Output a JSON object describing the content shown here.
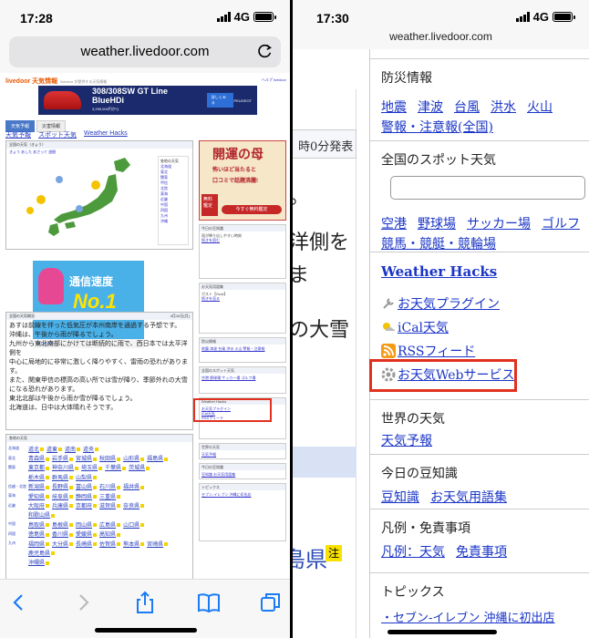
{
  "left": {
    "status": {
      "time": "17:28",
      "network": "4G"
    },
    "url": "weather.livedoor.com",
    "logo": "livedoor 天気情報",
    "logo_sub": "livedoor が提供する天気情報",
    "toplinks": "ヘルプ  livedoor",
    "ad": {
      "title": "308/308SW GT Line BlueHDi",
      "price": "3,299,000円から",
      "button": "詳しくみる",
      "brand": "PEUGEOT"
    },
    "tabs": [
      "天気予報",
      "災害情報"
    ],
    "nav": [
      "天気予報",
      "スポット天気",
      "Weather Hacks"
    ],
    "map": {
      "header": "全国の天気（きょう）",
      "links": "きょう  あした  あさって  週間",
      "regions_title": "各地の天気",
      "regions": [
        "北海道",
        "東北",
        "関東",
        "甲信",
        "北陸",
        "東海",
        "近畿",
        "中国",
        "四国",
        "九州",
        "沖縄"
      ]
    },
    "ad2": {
      "title": "通信速度",
      "no1": "No.1",
      "brand": "UQ mobile"
    },
    "forecast": {
      "header": "全国の天気概況",
      "date": "4月16日(月)",
      "lines": [
        "あすは前線を伴った低気圧が本州南岸を通過する予想です。",
        "沖縄は、午後から雨が降るでしょう。",
        "九州から東北南部にかけては断続的に雨で、西日本では太平洋側を",
        "中心に局地的に非常に激しく降りやすく、雷雨の恐れがあります。",
        "また、関東甲信の標高の高い所では雪が降り、季節外れの大雪",
        "になる恐れがあります。",
        "東北北部は午後から雨か雪が降るでしょう。",
        "北海道は、日中は大体晴れそうです。"
      ]
    },
    "pref": {
      "header": "各地の天気",
      "rows": [
        {
          "region": "北海道",
          "items": [
            "道北",
            "道東",
            "道南",
            "道央"
          ]
        },
        {
          "region": "東北",
          "items": [
            "青森県",
            "岩手県",
            "宮城県",
            "秋田県",
            "山形県",
            "福島県"
          ]
        },
        {
          "region": "関東",
          "items": [
            "東京都",
            "神奈川県",
            "埼玉県",
            "千葉県",
            "茨城県"
          ]
        },
        {
          "region": "",
          "items": [
            "栃木県",
            "群馬県",
            "山梨県"
          ]
        },
        {
          "region": "信越・北陸",
          "items": [
            "新潟県",
            "長野県",
            "富山県",
            "石川県",
            "福井県"
          ]
        },
        {
          "region": "東海",
          "items": [
            "愛知県",
            "岐阜県",
            "静岡県",
            "三重県"
          ]
        },
        {
          "region": "近畿",
          "items": [
            "大阪府",
            "兵庫県",
            "京都府",
            "滋賀県",
            "奈良県"
          ]
        },
        {
          "region": "",
          "items": [
            "和歌山県"
          ]
        },
        {
          "region": "中国",
          "items": [
            "鳥取県",
            "島根県",
            "岡山県",
            "広島県",
            "山口県"
          ]
        },
        {
          "region": "四国",
          "items": [
            "徳島県",
            "香川県",
            "愛媛県",
            "高知県"
          ]
        },
        {
          "region": "九州",
          "items": [
            "福岡県",
            "大分県",
            "長崎県",
            "佐賀県",
            "熊本県",
            "宮崎県"
          ]
        },
        {
          "region": "",
          "items": [
            "鹿児島県"
          ]
        },
        {
          "region": "",
          "items": [
            "沖縄県"
          ]
        }
      ]
    },
    "fortune": {
      "title": "開運の母",
      "line1": "怖いほど当たると",
      "line2": "口コミで話題沸騰!",
      "badge": "無料鑑定",
      "cta": "今すぐ無料鑑定"
    },
    "small_boxes": [
      {
        "title": "今日の豆知識",
        "text": "雨が降り出しやすい時刻",
        "link": "続きを読む"
      },
      {
        "title": "お天気用語集",
        "text": "ガスト【Gust】",
        "link": "続きを見る"
      },
      {
        "title": "防災情報",
        "text": "地震  津波  台風  洪水  火山  警報・注意報",
        "link": ""
      },
      {
        "title": "全国のスポット天気",
        "text": "空港  野球場  サッカー場  ゴルフ場",
        "link": "検索"
      },
      {
        "title": "Weather Hacks",
        "text": "お天気プラグイン",
        "link": "iCal天気"
      },
      {
        "title": "",
        "text": "",
        "link": "RSSフィード"
      },
      {
        "title": "世界の天気",
        "text": "",
        "link": "天気予報"
      },
      {
        "title": "今日の豆知識",
        "text": "",
        "link": "豆知識  お天気用語集"
      },
      {
        "title": "トピックス",
        "text": "セブン-イレブン 沖縄に初出店",
        "link": ""
      }
    ]
  },
  "right": {
    "status": {
      "time": "17:30",
      "network": "4G"
    },
    "url": "weather.livedoor.com",
    "background": {
      "heading": "時0分発表",
      "lines": [
        "。",
        "洋側を",
        "ま",
        "の大雪"
      ],
      "pref_link": "島県",
      "note": "注"
    },
    "bosai": {
      "title": "防災情報",
      "links1": [
        "地震",
        "津波",
        "台風",
        "洪水",
        "火山"
      ],
      "links2": [
        "警報・注意報(全国)"
      ]
    },
    "spot": {
      "title": "全国のスポット天気",
      "search_placeholder": "",
      "links1": [
        "空港",
        "野球場",
        "サッカー場",
        "ゴルフ"
      ],
      "links2": [
        "競馬・競艇・競輪場"
      ]
    },
    "hacks": {
      "title": "Weather Hacks",
      "items": [
        {
          "label": "お天気プラグイン",
          "icon": "wrench-icon"
        },
        {
          "label": "iCal天気",
          "icon": "ical-weather-icon"
        },
        {
          "label": "RSSフィード",
          "icon": "rss-icon"
        },
        {
          "label": "お天気Webサービス",
          "icon": "gear-icon"
        }
      ]
    },
    "world": {
      "title": "世界の天気",
      "link": "天気予報"
    },
    "trivia": {
      "title": "今日の豆知識",
      "links": [
        "豆知識",
        "お天気用語集"
      ]
    },
    "legend": {
      "title": "凡例・免責事項",
      "links": [
        "凡例：天気",
        "免責事項"
      ]
    },
    "topics": {
      "title": "トピックス",
      "item": "・セブン-イレブン 沖縄に初出店"
    }
  },
  "colors": {
    "link": "#1a35c7",
    "highlight": "#e0301e"
  }
}
